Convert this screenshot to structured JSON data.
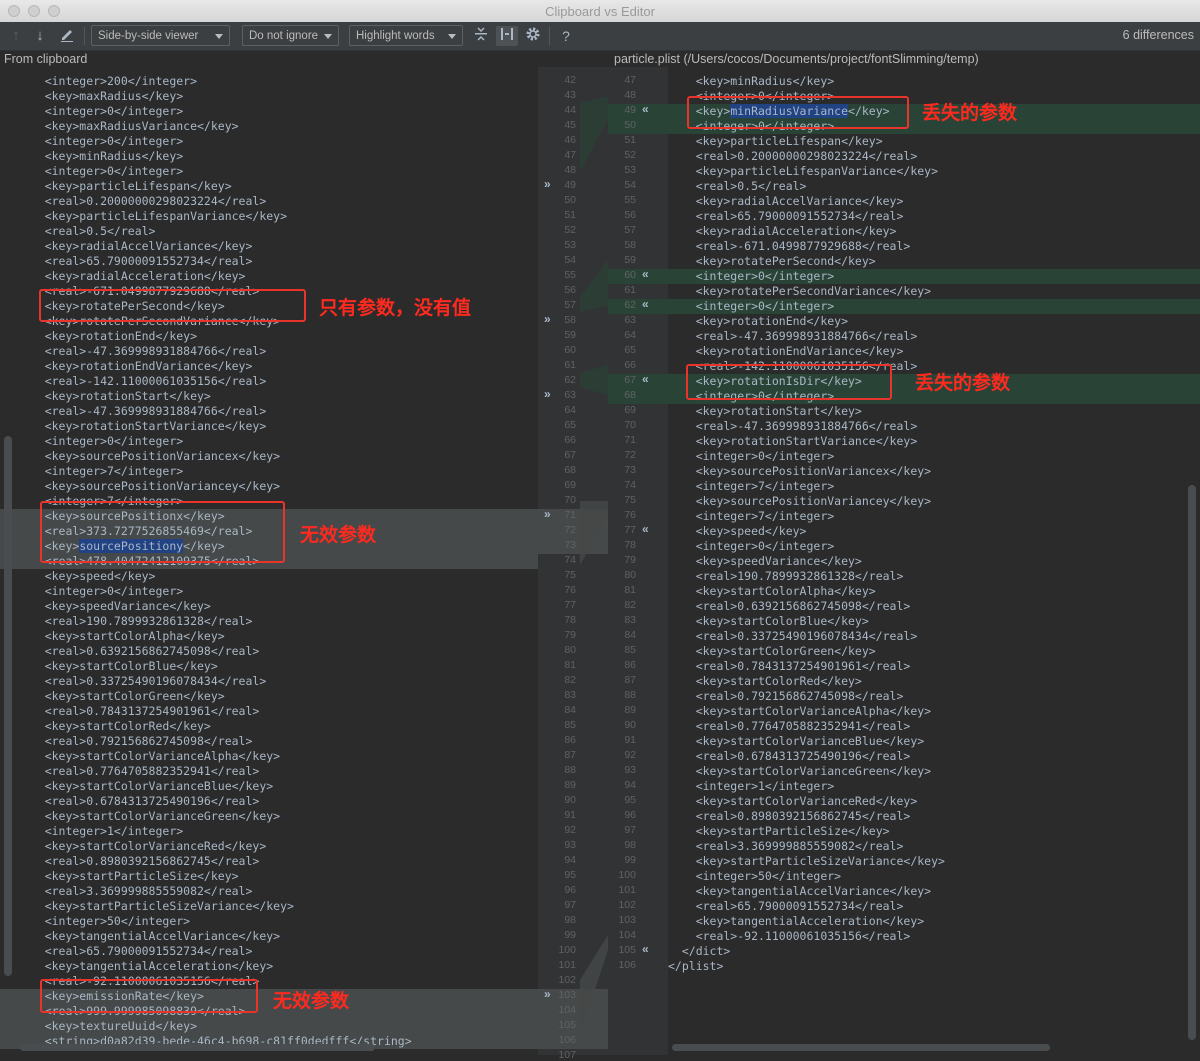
{
  "window": {
    "title": "Clipboard vs Editor"
  },
  "toolbar": {
    "viewer_label": "Side-by-side viewer",
    "ignore_label": "Do not ignore",
    "highlight_label": "Highlight words",
    "help_label": "?",
    "diff_count": "6 differences"
  },
  "left": {
    "header": "From clipboard",
    "lines": [
      "    <integer>200</integer>",
      "    <key>maxRadius</key>",
      "    <integer>0</integer>",
      "    <key>maxRadiusVariance</key>",
      "    <integer>0</integer>",
      "    <key>minRadius</key>",
      "    <integer>0</integer>",
      "    <key>particleLifespan</key>",
      "    <real>0.20000000298023224</real>",
      "    <key>particleLifespanVariance</key>",
      "    <real>0.5</real>",
      "    <key>radialAccelVariance</key>",
      "    <real>65.79000091552734</real>",
      "    <key>radialAcceleration</key>",
      "    <real>-671.0499877929688</real>",
      "    <key>rotatePerSecond</key>",
      "    <key>rotatePerSecondVariance</key>",
      "    <key>rotationEnd</key>",
      "    <real>-47.369998931884766</real>",
      "    <key>rotationEndVariance</key>",
      "    <real>-142.11000061035156</real>",
      "    <key>rotationStart</key>",
      "    <real>-47.369998931884766</real>",
      "    <key>rotationStartVariance</key>",
      "    <integer>0</integer>",
      "    <key>sourcePositionVariancex</key>",
      "    <integer>7</integer>",
      "    <key>sourcePositionVariancey</key>",
      "    <integer>7</integer>",
      "    <key>sourcePositionx</key>",
      "    <real>373.7277526855469</real>",
      "    <key>sourcePositiony</key>",
      "    <real>478.40472412109375</real>",
      "    <key>speed</key>",
      "    <integer>0</integer>",
      "    <key>speedVariance</key>",
      "    <real>190.7899932861328</real>",
      "    <key>startColorAlpha</key>",
      "    <real>0.6392156862745098</real>",
      "    <key>startColorBlue</key>",
      "    <real>0.33725490196078434</real>",
      "    <key>startColorGreen</key>",
      "    <real>0.7843137254901961</real>",
      "    <key>startColorRed</key>",
      "    <real>0.792156862745098</real>",
      "    <key>startColorVarianceAlpha</key>",
      "    <real>0.7764705882352941</real>",
      "    <key>startColorVarianceBlue</key>",
      "    <real>0.6784313725490196</real>",
      "    <key>startColorVarianceGreen</key>",
      "    <integer>1</integer>",
      "    <key>startColorVarianceRed</key>",
      "    <real>0.8980392156862745</real>",
      "    <key>startParticleSize</key>",
      "    <real>3.369999885559082</real>",
      "    <key>startParticleSizeVariance</key>",
      "    <integer>50</integer>",
      "    <key>tangentialAccelVariance</key>",
      "    <real>65.79000091552734</real>",
      "    <key>tangentialAcceleration</key>",
      "    <real>-92.11000061035156</real>",
      "    <key>emissionRate</key>",
      "    <real>999.999985098839</real>",
      "    <key>textureUuid</key>",
      "    <string>d0a82d39-bede-46c4-b698-c81ff0dedfff</string>"
    ],
    "numbers": [
      "42",
      "43",
      "44",
      "45",
      "46",
      "47",
      "48",
      "49",
      "50",
      "51",
      "52",
      "53",
      "54",
      "55",
      "56",
      "57",
      "58",
      "59",
      "60",
      "61",
      "62",
      "63",
      "64",
      "65",
      "66",
      "67",
      "68",
      "69",
      "70",
      "71",
      "72",
      "73",
      "74",
      "75",
      "76",
      "77",
      "78",
      "79",
      "80",
      "81",
      "82",
      "83",
      "84",
      "85",
      "86",
      "87",
      "88",
      "89",
      "90",
      "91",
      "92",
      "93",
      "94",
      "95",
      "96",
      "97",
      "98",
      "99",
      "100",
      "101",
      "102",
      "103",
      "104",
      "105",
      "106",
      "107"
    ]
  },
  "right": {
    "header": "particle.plist (/Users/cocos/Documents/project/fontSlimming/temp)",
    "lines": [
      "    <key>minRadius</key>",
      "    <integer>0</integer>",
      "    <key>minRadiusVariance</key>",
      "    <integer>0</integer>",
      "    <key>particleLifespan</key>",
      "    <real>0.20000000298023224</real>",
      "    <key>particleLifespanVariance</key>",
      "    <real>0.5</real>",
      "    <key>radialAccelVariance</key>",
      "    <real>65.79000091552734</real>",
      "    <key>radialAcceleration</key>",
      "    <real>-671.0499877929688</real>",
      "    <key>rotatePerSecond</key>",
      "    <integer>0</integer>",
      "    <key>rotatePerSecondVariance</key>",
      "    <integer>0</integer>",
      "    <key>rotationEnd</key>",
      "    <real>-47.369998931884766</real>",
      "    <key>rotationEndVariance</key>",
      "    <real>-142.11000061035156</real>",
      "    <key>rotationIsDir</key>",
      "    <integer>0</integer>",
      "    <key>rotationStart</key>",
      "    <real>-47.369998931884766</real>",
      "    <key>rotationStartVariance</key>",
      "    <integer>0</integer>",
      "    <key>sourcePositionVariancex</key>",
      "    <integer>7</integer>",
      "    <key>sourcePositionVariancey</key>",
      "    <integer>7</integer>",
      "    <key>speed</key>",
      "    <integer>0</integer>",
      "    <key>speedVariance</key>",
      "    <real>190.7899932861328</real>",
      "    <key>startColorAlpha</key>",
      "    <real>0.6392156862745098</real>",
      "    <key>startColorBlue</key>",
      "    <real>0.33725490196078434</real>",
      "    <key>startColorGreen</key>",
      "    <real>0.7843137254901961</real>",
      "    <key>startColorRed</key>",
      "    <real>0.792156862745098</real>",
      "    <key>startColorVarianceAlpha</key>",
      "    <real>0.7764705882352941</real>",
      "    <key>startColorVarianceBlue</key>",
      "    <real>0.6784313725490196</real>",
      "    <key>startColorVarianceGreen</key>",
      "    <integer>1</integer>",
      "    <key>startColorVarianceRed</key>",
      "    <real>0.8980392156862745</real>",
      "    <key>startParticleSize</key>",
      "    <real>3.369999885559082</real>",
      "    <key>startParticleSizeVariance</key>",
      "    <integer>50</integer>",
      "    <key>tangentialAccelVariance</key>",
      "    <real>65.79000091552734</real>",
      "    <key>tangentialAcceleration</key>",
      "    <real>-92.11000061035156</real>",
      "  </dict>",
      "</plist>"
    ],
    "numbers": [
      "47",
      "48",
      "49",
      "50",
      "51",
      "52",
      "53",
      "54",
      "55",
      "56",
      "57",
      "58",
      "59",
      "60",
      "61",
      "62",
      "63",
      "64",
      "65",
      "66",
      "67",
      "68",
      "69",
      "70",
      "71",
      "72",
      "73",
      "74",
      "75",
      "76",
      "77",
      "78",
      "79",
      "80",
      "81",
      "82",
      "83",
      "84",
      "85",
      "86",
      "87",
      "88",
      "89",
      "90",
      "91",
      "92",
      "93",
      "94",
      "95",
      "96",
      "97",
      "98",
      "99",
      "100",
      "101",
      "102",
      "103",
      "104",
      "105",
      "106"
    ]
  },
  "annotations": {
    "missing_param_1": "丢失的参数",
    "key_no_value": "只有参数，没有值",
    "missing_param_2": "丢失的参数",
    "invalid_param_1": "无效参数",
    "invalid_param_2": "无效参数"
  },
  "colors": {
    "editor_bg": "#2b2b2b",
    "inserted_bg": "#294436",
    "changed_bg": "#464949",
    "annotation_red": "#e8342b"
  }
}
